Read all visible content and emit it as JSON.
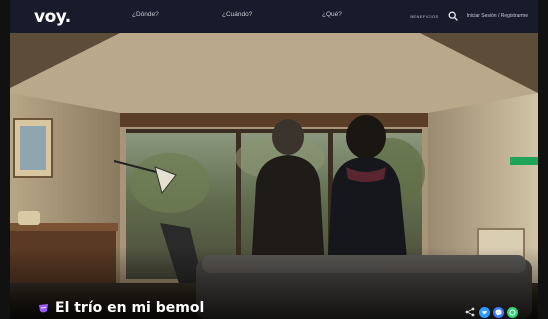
{
  "header": {
    "logo": "voy.",
    "nav": [
      "¿Dónde?",
      "¿Cuándo?",
      "¿Qué?"
    ],
    "small_link": "BENEFICIOS",
    "search_icon": "search-icon",
    "login": "Iniciar Sesión / Registrarme"
  },
  "hero": {
    "title": "El trío en mi bemol",
    "badge_icon": "theatre-mask-icon"
  },
  "share": {
    "share_icon": "share-icon",
    "buttons": [
      {
        "name": "twitter-share-button",
        "color": "#2d9cff",
        "glyph": "t"
      },
      {
        "name": "messenger-share-button",
        "color": "#3b7bff",
        "glyph": "m"
      },
      {
        "name": "whatsapp-share-button",
        "color": "#33d17a",
        "glyph": "w"
      }
    ]
  },
  "colors": {
    "header_bg": "#181b2c",
    "title_text": "#ffffff",
    "accent": "#9b5cff"
  }
}
